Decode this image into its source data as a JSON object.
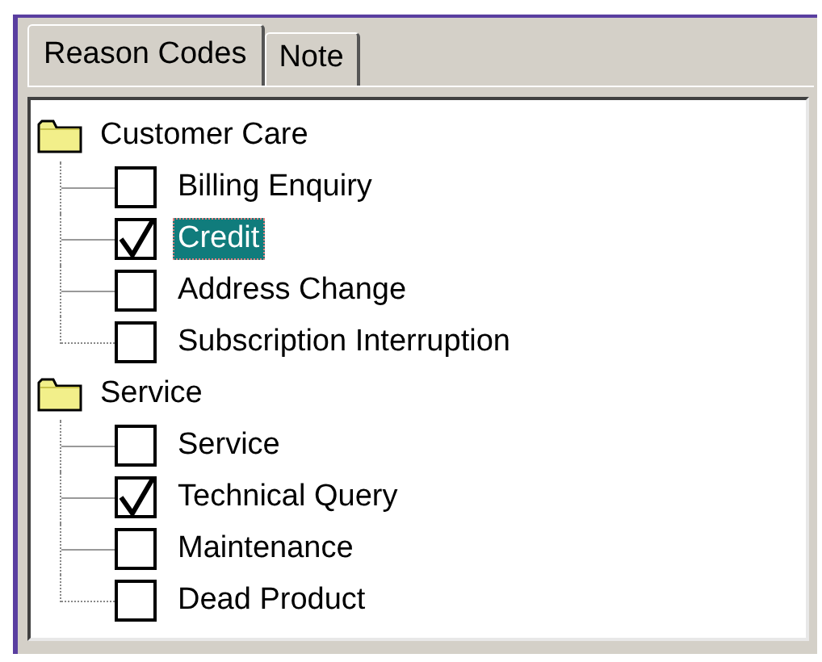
{
  "tabs": [
    {
      "label": "Reason Codes",
      "selected": true
    },
    {
      "label": "Note",
      "selected": false
    }
  ],
  "tree": [
    {
      "label": "Customer Care",
      "children": [
        {
          "label": "Billing Enquiry",
          "checked": false,
          "selected": false
        },
        {
          "label": "Credit",
          "checked": true,
          "selected": true
        },
        {
          "label": "Address Change",
          "checked": false,
          "selected": false
        },
        {
          "label": "Subscription Interruption",
          "checked": false,
          "selected": false
        }
      ]
    },
    {
      "label": "Service",
      "children": [
        {
          "label": "Service",
          "checked": false,
          "selected": false
        },
        {
          "label": "Technical Query",
          "checked": true,
          "selected": false
        },
        {
          "label": "Maintenance",
          "checked": false,
          "selected": false
        },
        {
          "label": "Dead Product",
          "checked": false,
          "selected": false
        }
      ]
    }
  ]
}
